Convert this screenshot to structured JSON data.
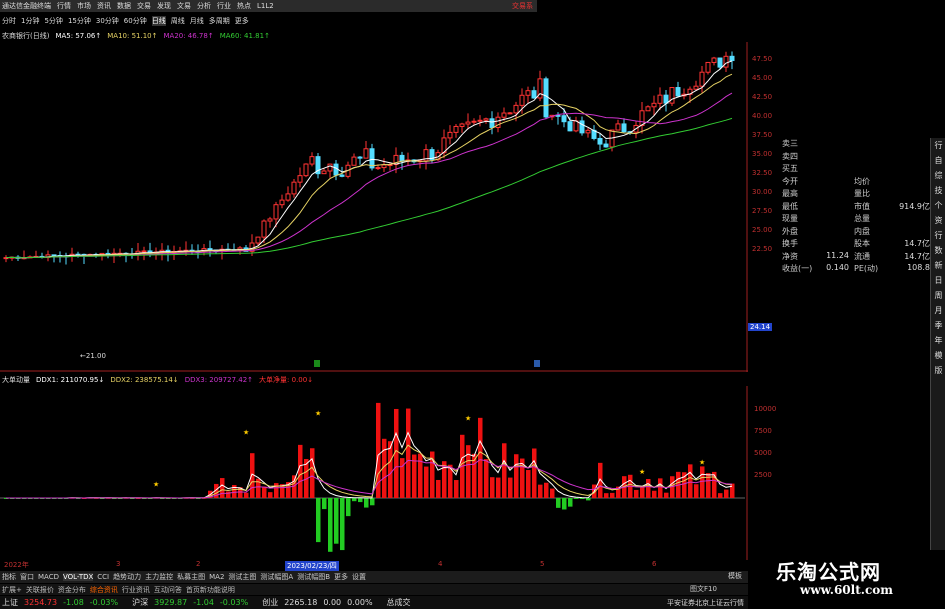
{
  "titlebar": {
    "app_name": "通达信金融终端",
    "menus": [
      "行情",
      "市场",
      "资讯",
      "数据",
      "交易",
      "发现",
      "文易",
      "分析",
      "行业",
      "热点"
    ],
    "tag": "L1L2",
    "brand_right": "交易系"
  },
  "toolbar": {
    "periods": [
      "分时",
      "1分钟",
      "5分钟",
      "15分钟",
      "30分钟",
      "60分钟",
      "日线",
      "周线",
      "月线",
      "多周期",
      "更多"
    ],
    "active": "日线"
  },
  "ma_header": {
    "stock": "农商银行(日线)",
    "ma5": "MA5: 57.06↑",
    "ma10": "MA10: 51.10↑",
    "ma20": "MA20: 46.78↑",
    "ma60": "MA60: 41.81↑",
    "colors": {
      "ma5": "#ffffff",
      "ma10": "#e6d264",
      "ma20": "#cc33cc",
      "ma60": "#33cc33"
    }
  },
  "price_axis": {
    "ticks": [
      "47.50",
      "45.00",
      "42.50",
      "40.00",
      "37.50",
      "35.00",
      "32.50",
      "30.00",
      "27.50",
      "25.00",
      "22.50"
    ],
    "current_tag": "24.14"
  },
  "info_panel": {
    "rows": [
      {
        "l": "卖三",
        "lv": "",
        "r": "",
        "rv": ""
      },
      {
        "l": "卖四",
        "lv": "",
        "r": "",
        "rv": ""
      },
      {
        "l": "买五",
        "lv": "",
        "r": "",
        "rv": ""
      },
      {
        "l": "今开",
        "lv": "",
        "r": "均价",
        "rv": ""
      },
      {
        "l": "最高",
        "lv": "",
        "r": "量比",
        "rv": ""
      },
      {
        "l": "最低",
        "lv": "",
        "r": "市值",
        "rv": "914.9亿"
      },
      {
        "l": "现量",
        "lv": "",
        "r": "总量",
        "rv": ""
      },
      {
        "l": "外盘",
        "lv": "",
        "r": "内盘",
        "rv": ""
      },
      {
        "l": "换手",
        "lv": "",
        "r": "股本",
        "rv": "14.7亿"
      },
      {
        "l": "净资",
        "lv": "11.24",
        "r": "流通",
        "rv": "14.7亿"
      },
      {
        "l": "收益(一)",
        "lv": "0.140",
        "r": "PE(动)",
        "rv": "108.8"
      }
    ]
  },
  "vol_header": {
    "name": "大单动量",
    "ddx1": "DDX1: 211070.95↓",
    "ddx2": "DDX2: 238575.14↓",
    "ddx3": "DDX3: 209727.42↑",
    "big": "大单净量: 0.00↓"
  },
  "vol_axis": {
    "ticks": [
      "10000",
      "7500",
      "5000",
      "2500"
    ]
  },
  "x_axis": {
    "labels": [
      "2022年",
      "3",
      "2",
      "2023/02/23/四",
      "4",
      "5",
      "6"
    ]
  },
  "tabs": [
    "指标",
    "窗口",
    "MACD",
    "VOL-TDX",
    "CCI",
    "趋势动力",
    "主力监控",
    "私募主图",
    "MA2",
    "测试主图",
    "测试幅图A",
    "测试幅图B",
    "更多",
    "设置"
  ],
  "tabs2": [
    "扩展+",
    "关联报价",
    "资金分布",
    "综合资讯",
    "行业资讯",
    "互动问答",
    "首页新功能说明"
  ],
  "status": {
    "sh_name": "上证",
    "sh_val": "3254.73",
    "sh_chg": "-1.08",
    "sh_pct": "-0.03%",
    "sz_name": "沪深",
    "sz_val": "3929.87",
    "sz_chg": "-1.04",
    "sz_pct": "-0.03%",
    "cy_name": "创业",
    "cy_val": "2265.18",
    "cy_chg": "0.00",
    "cy_pct": "0.00%",
    "deal": "总成交",
    "broker": "平安证券北京上证云行情"
  },
  "sidenav": [
    "行",
    "自",
    "综",
    "技",
    "个",
    "资",
    "行",
    "数",
    "新",
    "日",
    "周",
    "月",
    "季",
    "年",
    "模",
    "版"
  ],
  "promo": {
    "title": "乐淘公式网",
    "url": "www.60lt.com"
  },
  "label_mode": "模板",
  "label_diag": "图文F10",
  "colors": {
    "up": "#ff3333",
    "down": "#33cc33",
    "bg": "#000000",
    "grid": "#7a1a1a",
    "axis": "#a02020"
  }
}
